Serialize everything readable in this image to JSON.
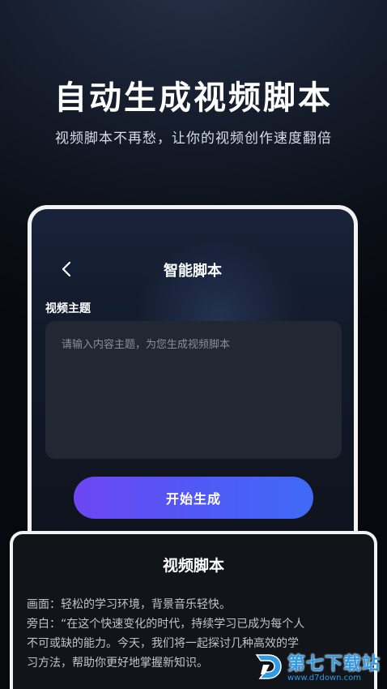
{
  "hero": {
    "title": "自动生成视频脚本",
    "subtitle": "视频脚本不再愁，让你的视频创作速度翻倍"
  },
  "screen": {
    "title": "智能脚本",
    "back_icon": "chevron-left-icon",
    "topic_label": "视频主题",
    "topic_input": {
      "value": "",
      "placeholder": "请输入内容主题，为您生成视频脚本"
    },
    "generate_button": "开始生成",
    "button_gradient": [
      "#6c46f2",
      "#3f6af6"
    ]
  },
  "result": {
    "title": "视频脚本",
    "lines": [
      "画面：轻松的学习环境，背景音乐轻快。",
      "旁白：“在这个快速变化的时代，持续学习已成为每个人",
      "不可或缺的能力。今天，我们将一起探讨几种高效的学",
      "习方法，帮助你更好地掌握新知识。"
    ]
  },
  "watermark": {
    "name": "第七下载站",
    "url": "www.d7down.com",
    "color": "#2e9be6"
  }
}
